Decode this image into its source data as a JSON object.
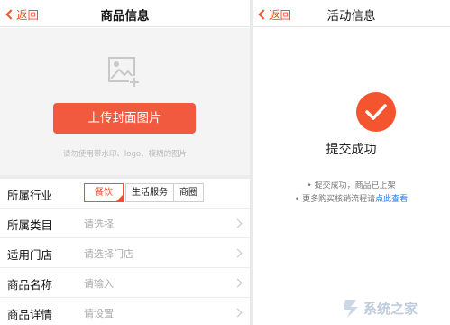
{
  "left": {
    "back_label": "返回",
    "title": "商品信息",
    "upload_button": "上传封面图片",
    "upload_tip": "请勿使用带水印、logo、模糊的图片",
    "industry": {
      "label": "所属行业",
      "chips": [
        "餐饮",
        "生活服务",
        "商圈"
      ],
      "selected": "餐饮"
    },
    "rows": [
      {
        "label": "所属类目",
        "value": "请选择"
      },
      {
        "label": "适用门店",
        "value": "请选择门店"
      },
      {
        "label": "商品名称",
        "value": "请输入"
      },
      {
        "label": "商品详情",
        "value": "请设置"
      }
    ]
  },
  "right": {
    "back_label": "返回",
    "title": "活动信息",
    "status_text": "提交成功",
    "info_1": "• 提交成功，商品已上架",
    "info_2_prefix": "• 更多购买核销流程请",
    "info_2_link": "点此查看"
  },
  "colors": {
    "accent": "#f05030",
    "button": "#f25a3f",
    "link": "#2a7de1"
  },
  "icons": {
    "image_placeholder": "image-add-icon",
    "success": "checkmark-circle-icon",
    "back": "chevron-left-icon",
    "row_arrow": "chevron-right-icon"
  },
  "watermark": {
    "text": "系统之家"
  }
}
